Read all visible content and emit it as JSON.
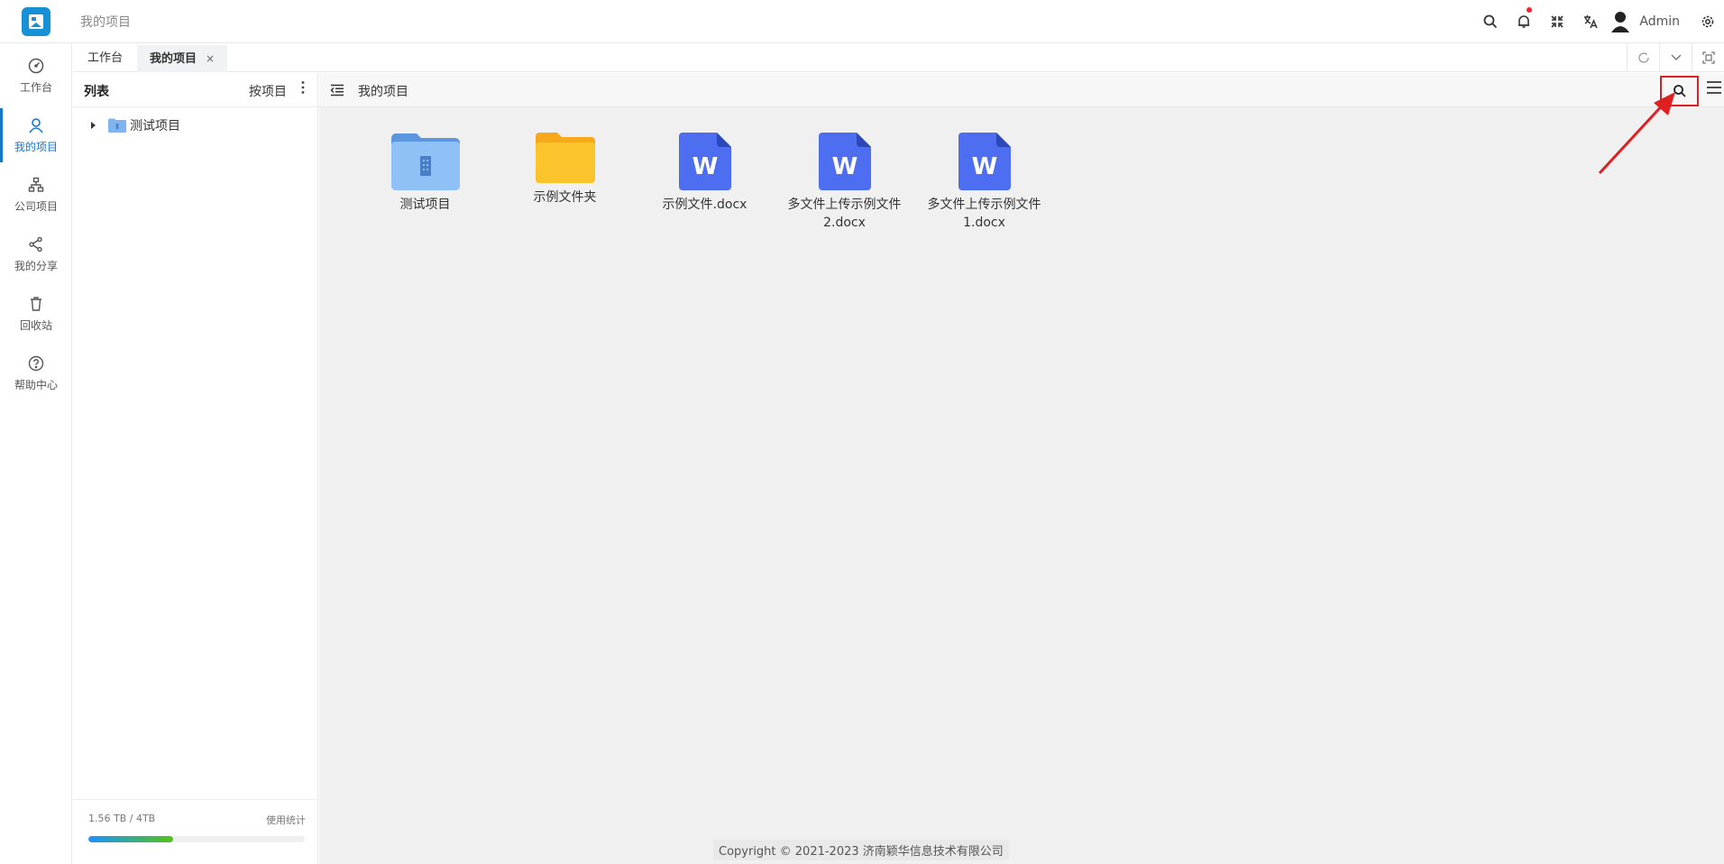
{
  "header": {
    "breadcrumb": "我的项目",
    "user_name": "Admin",
    "icons": [
      "search-icon",
      "bell-icon",
      "fullscreen-icon",
      "translate-icon",
      "user-icon",
      "gear-icon"
    ]
  },
  "rail": {
    "items": [
      {
        "label": "工作台",
        "icon": "dashboard-icon"
      },
      {
        "label": "我的项目",
        "icon": "user-icon",
        "active": true
      },
      {
        "label": "公司项目",
        "icon": "org-icon"
      },
      {
        "label": "我的分享",
        "icon": "share-icon"
      },
      {
        "label": "回收站",
        "icon": "trash-icon"
      },
      {
        "label": "帮助中心",
        "icon": "help-icon"
      }
    ]
  },
  "tabs": {
    "items": [
      {
        "label": "工作台"
      },
      {
        "label": "我的项目",
        "active": true,
        "close": "×"
      }
    ]
  },
  "tree": {
    "title": "列表",
    "sort_label": "按项目",
    "nodes": [
      {
        "label": "测试项目"
      }
    ]
  },
  "storage": {
    "used_text": "1.56 TB / 4TB",
    "stats_link": "使用统计",
    "usage_fraction": 0.39
  },
  "content": {
    "title": "我的项目",
    "files": [
      {
        "name": "测试项目",
        "type": "project-folder"
      },
      {
        "name": "示例文件夹",
        "type": "folder"
      },
      {
        "name": "示例文件.docx",
        "type": "word"
      },
      {
        "name": "多文件上传示例文件2.docx",
        "type": "word"
      },
      {
        "name": "多文件上传示例文件1.docx",
        "type": "word"
      }
    ],
    "copyright": "Copyright © 2021-2023 济南颖华信息技术有限公司"
  },
  "colors": {
    "accent": "#1677c8",
    "highlight": "#e02020",
    "word": "#4e6ef2",
    "folder": "#fcc42c"
  }
}
